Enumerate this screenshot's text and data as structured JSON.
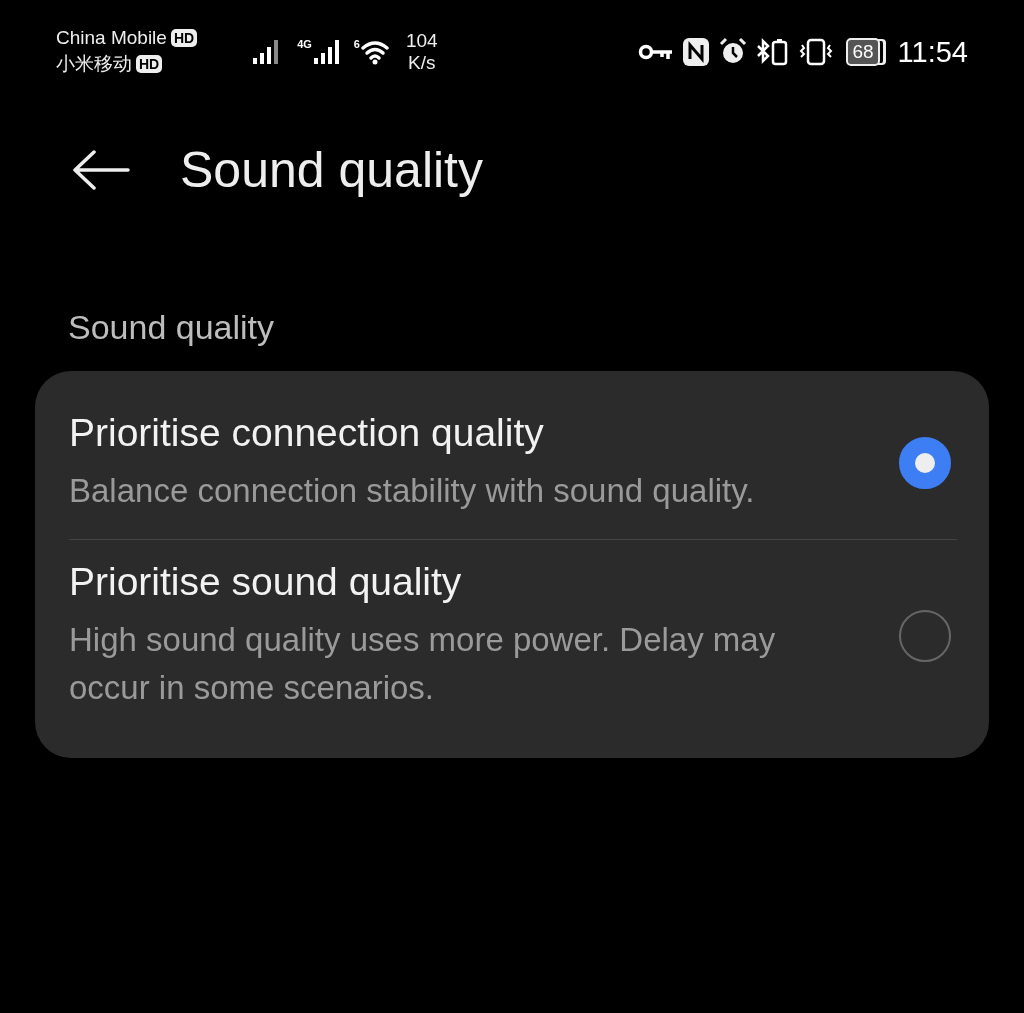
{
  "status_bar": {
    "carriers": [
      {
        "name": "China Mobile",
        "badge": "HD"
      },
      {
        "name": "小米移动",
        "badge": "HD"
      }
    ],
    "network": "4G",
    "wifi_label": "6",
    "speed": "104",
    "speed_unit": "K/s",
    "battery": "68",
    "time": "11:54"
  },
  "header": {
    "title": "Sound quality"
  },
  "section": {
    "label": "Sound quality"
  },
  "options": [
    {
      "title": "Prioritise connection quality",
      "description": "Balance connection stability with sound quality.",
      "selected": true
    },
    {
      "title": "Prioritise sound quality",
      "description": "High sound quality uses more power. Delay may occur in some scenarios.",
      "selected": false
    }
  ]
}
